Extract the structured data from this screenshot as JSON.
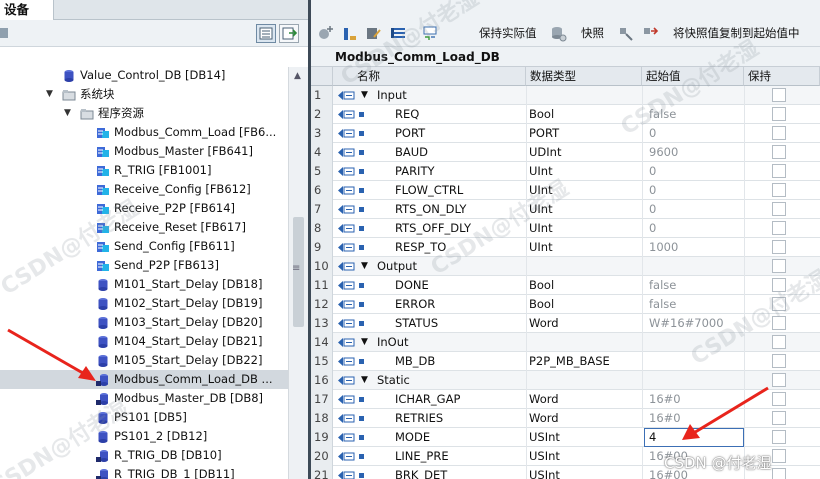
{
  "left_panel": {
    "tab_label": "设备",
    "tree_items": [
      {
        "label": "Value_Control_DB [DB14]",
        "icon": "db-icon"
      },
      {
        "label": "系统块",
        "icon": "folder-icon"
      },
      {
        "label": "程序资源",
        "icon": "folder-icon"
      },
      {
        "label": "Modbus_Comm_Load [FB6...",
        "icon": "fb-icon"
      },
      {
        "label": "Modbus_Master [FB641]",
        "icon": "fb-icon"
      },
      {
        "label": "R_TRIG [FB1001]",
        "icon": "fb-icon"
      },
      {
        "label": "Receive_Config [FB612]",
        "icon": "fb-icon"
      },
      {
        "label": "Receive_P2P [FB614]",
        "icon": "fb-icon"
      },
      {
        "label": "Receive_Reset [FB617]",
        "icon": "fb-icon"
      },
      {
        "label": "Send_Config [FB611]",
        "icon": "fb-icon"
      },
      {
        "label": "Send_P2P [FB613]",
        "icon": "fb-icon"
      },
      {
        "label": "M101_Start_Delay [DB18]",
        "icon": "db-icon"
      },
      {
        "label": "M102_Start_Delay [DB19]",
        "icon": "db-icon"
      },
      {
        "label": "M103_Start_Delay [DB20]",
        "icon": "db-icon"
      },
      {
        "label": "M104_Start_Delay [DB21]",
        "icon": "db-icon"
      },
      {
        "label": "M105_Start_Delay [DB22]",
        "icon": "db-icon"
      },
      {
        "label": "Modbus_Comm_Load_DB ...",
        "icon": "instance-db-icon"
      },
      {
        "label": "Modbus_Master_DB [DB8]",
        "icon": "instance-db-icon"
      },
      {
        "label": "PS101 [DB5]",
        "icon": "db-icon"
      },
      {
        "label": "PS101_2 [DB12]",
        "icon": "db-icon"
      },
      {
        "label": "R_TRIG_DB [DB10]",
        "icon": "instance-db-icon"
      },
      {
        "label": "R_TRIG_DB_1 [DB11]",
        "icon": "instance-db-icon"
      }
    ]
  },
  "toolbar": {
    "keep_actual_label": "保持实际值",
    "snapshot_label": "快照",
    "copy_snapshot_label": "将快照值复制到起始值中"
  },
  "editor": {
    "db_title": "Modbus_Comm_Load_DB",
    "columns": {
      "name": "名称",
      "type": "数据类型",
      "start": "起始值",
      "retain": "保持"
    },
    "rows": [
      {
        "num": "1",
        "name": "Input",
        "type": "",
        "start": "",
        "section": true
      },
      {
        "num": "2",
        "name": "REQ",
        "type": "Bool",
        "start": "false"
      },
      {
        "num": "3",
        "name": "PORT",
        "type": "PORT",
        "start": "0"
      },
      {
        "num": "4",
        "name": "BAUD",
        "type": "UDInt",
        "start": "9600"
      },
      {
        "num": "5",
        "name": "PARITY",
        "type": "UInt",
        "start": "0"
      },
      {
        "num": "6",
        "name": "FLOW_CTRL",
        "type": "UInt",
        "start": "0"
      },
      {
        "num": "7",
        "name": "RTS_ON_DLY",
        "type": "UInt",
        "start": "0"
      },
      {
        "num": "8",
        "name": "RTS_OFF_DLY",
        "type": "UInt",
        "start": "0"
      },
      {
        "num": "9",
        "name": "RESP_TO",
        "type": "UInt",
        "start": "1000"
      },
      {
        "num": "10",
        "name": "Output",
        "type": "",
        "start": "",
        "section": true
      },
      {
        "num": "11",
        "name": "DONE",
        "type": "Bool",
        "start": "false"
      },
      {
        "num": "12",
        "name": "ERROR",
        "type": "Bool",
        "start": "false"
      },
      {
        "num": "13",
        "name": "STATUS",
        "type": "Word",
        "start": "W#16#7000"
      },
      {
        "num": "14",
        "name": "InOut",
        "type": "",
        "start": "",
        "section": true
      },
      {
        "num": "15",
        "name": "MB_DB",
        "type": "P2P_MB_BASE",
        "start": ""
      },
      {
        "num": "16",
        "name": "Static",
        "type": "",
        "start": "",
        "section": true
      },
      {
        "num": "17",
        "name": "ICHAR_GAP",
        "type": "Word",
        "start": "16#0"
      },
      {
        "num": "18",
        "name": "RETRIES",
        "type": "Word",
        "start": "16#0"
      },
      {
        "num": "19",
        "name": "MODE",
        "type": "USInt",
        "start": "4",
        "editing": true
      },
      {
        "num": "20",
        "name": "LINE_PRE",
        "type": "USInt",
        "start": "16#00"
      },
      {
        "num": "21",
        "name": "BRK_DET",
        "type": "USInt",
        "start": "16#00"
      }
    ]
  },
  "watermark": {
    "text": "CSDN@付老湿",
    "credit": "CSDN @付老湿"
  },
  "colors": {
    "accent": "#2a62b0",
    "annotation_red": "#e8241c"
  }
}
